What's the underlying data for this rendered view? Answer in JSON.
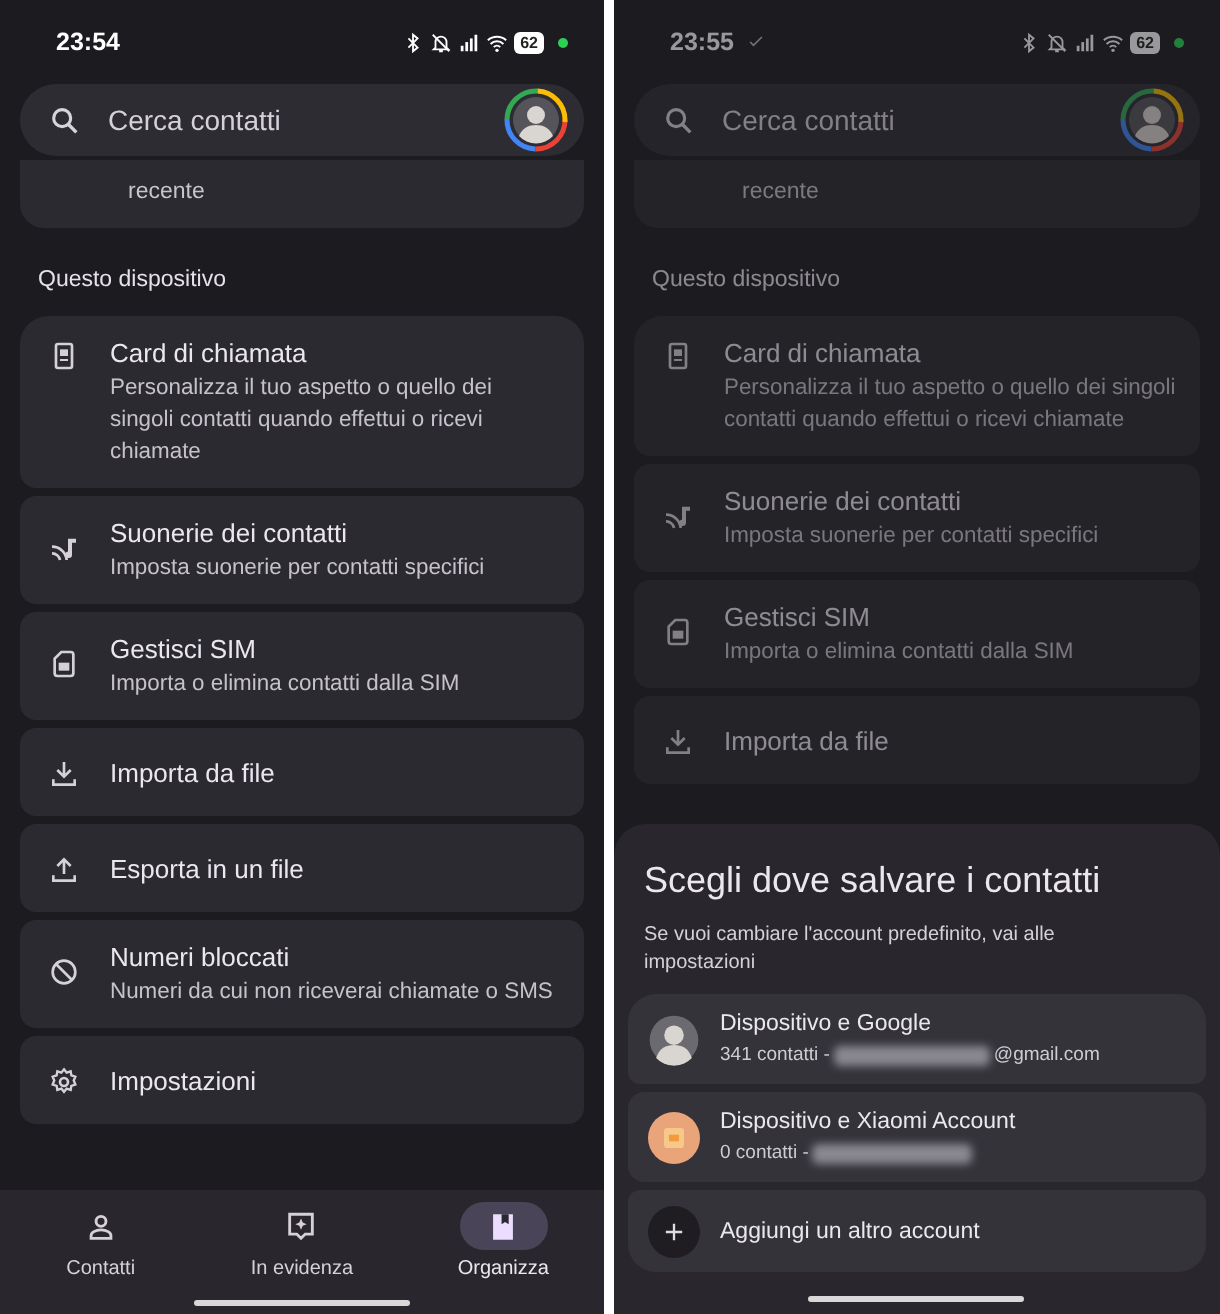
{
  "screens": [
    {
      "status_bar": {
        "time": "23:54",
        "synced": false,
        "battery": "62"
      },
      "search": {
        "placeholder": "Cerca contatti"
      },
      "partial_card": {
        "text": "recente"
      },
      "section": "Questo dispositivo",
      "items": [
        {
          "title": "Card di chiamata",
          "subtitle": "Personalizza il tuo aspetto o quello dei singoli contatti quando effettui o ricevi chiamate"
        },
        {
          "title": "Suonerie dei contatti",
          "subtitle": "Imposta suonerie per contatti specifici"
        },
        {
          "title": "Gestisci SIM",
          "subtitle": "Importa o elimina contatti dalla SIM"
        },
        {
          "title": "Importa da file"
        },
        {
          "title": "Esporta in un file"
        },
        {
          "title": "Numeri bloccati",
          "subtitle": "Numeri da cui non riceverai chiamate o SMS"
        },
        {
          "title": "Impostazioni"
        }
      ],
      "nav": [
        {
          "label": "Contatti",
          "selected": false
        },
        {
          "label": "In evidenza",
          "selected": false
        },
        {
          "label": "Organizza",
          "selected": true
        }
      ]
    },
    {
      "status_bar": {
        "time": "23:55",
        "synced": true,
        "battery": "62"
      },
      "search": {
        "placeholder": "Cerca contatti"
      },
      "partial_card": {
        "text": "recente"
      },
      "section": "Questo dispositivo",
      "items": [
        {
          "title": "Card di chiamata",
          "subtitle": "Personalizza il tuo aspetto o quello dei singoli contatti quando effettui o ricevi chiamate"
        },
        {
          "title": "Suonerie dei contatti",
          "subtitle": "Imposta suonerie per contatti specifici"
        },
        {
          "title": "Gestisci SIM",
          "subtitle": "Importa o elimina contatti dalla SIM"
        },
        {
          "title": "Importa da file"
        }
      ],
      "sheet": {
        "title": "Scegli dove salvare i contatti",
        "subtitle": "Se vuoi cambiare l'account predefinito, vai alle impostazioni",
        "accounts": [
          {
            "kind": "google",
            "name": "Dispositivo e Google",
            "detail_prefix": "341 contatti -",
            "redacted": true,
            "detail_suffix": "@gmail.com"
          },
          {
            "kind": "xiaomi",
            "name": "Dispositivo e Xiaomi Account",
            "detail_prefix": "0 contatti -",
            "redacted": true
          },
          {
            "kind": "add",
            "name": "Aggiungi un altro account"
          }
        ]
      }
    }
  ]
}
